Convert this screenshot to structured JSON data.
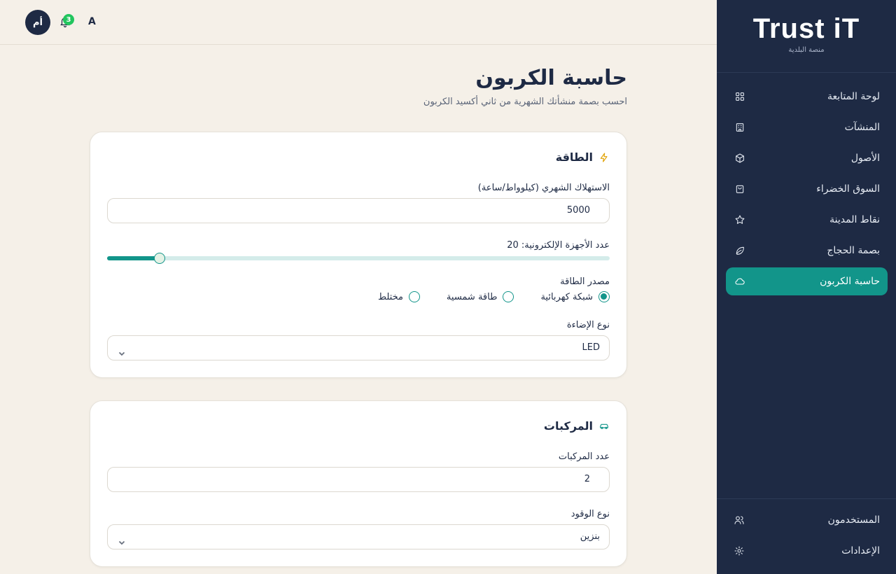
{
  "brand": {
    "title": "Trust iT",
    "subtitle": "منصة البلدية"
  },
  "header": {
    "avatar_initials": "أم",
    "notification_count": "3",
    "lang_toggle": "A"
  },
  "sidebar": {
    "items": [
      {
        "label": "لوحة المتابعة",
        "icon": "dashboard-icon"
      },
      {
        "label": "المنشآت",
        "icon": "building-icon"
      },
      {
        "label": "الأصول",
        "icon": "box-icon"
      },
      {
        "label": "السوق الخضراء",
        "icon": "shopping-bag-icon"
      },
      {
        "label": "نقاط المدينة",
        "icon": "star-icon"
      },
      {
        "label": "بصمة الحجاج",
        "icon": "leaf-icon"
      },
      {
        "label": "حاسبة الكربون",
        "icon": "cloud-icon",
        "active": true
      }
    ],
    "bottom_items": [
      {
        "label": "المستخدمون",
        "icon": "users-icon"
      },
      {
        "label": "الإعدادات",
        "icon": "gear-icon"
      }
    ]
  },
  "page": {
    "title": "حاسبة الكربون",
    "subtitle": "احسب بصمة منشأتك الشهرية من ثاني أكسيد الكربون"
  },
  "energy": {
    "title": "الطاقة",
    "consumption_label": "الاستهلاك الشهري (كيلوواط/ساعة)",
    "consumption_value": "5000",
    "devices_label": "عدد الأجهزة الإلكترونية: 20",
    "devices_fraction": 0.105,
    "source_label": "مصدر الطاقة",
    "source_options": [
      "شبكة كهربائية",
      "طاقة شمسية",
      "مختلط"
    ],
    "source_selected": "شبكة كهربائية",
    "lighting_label": "نوع الإضاءة",
    "lighting_value": "LED"
  },
  "vehicles": {
    "title": "المركبات",
    "count_label": "عدد المركبات",
    "count_value": "2",
    "fuel_label": "نوع الوقود",
    "fuel_value": "بنزين"
  },
  "colors": {
    "sidebar": "#1e2a44",
    "accent": "#12958a",
    "background": "#f5f0e8",
    "badge": "#22c55e",
    "energy_icon": "#e0a100"
  }
}
